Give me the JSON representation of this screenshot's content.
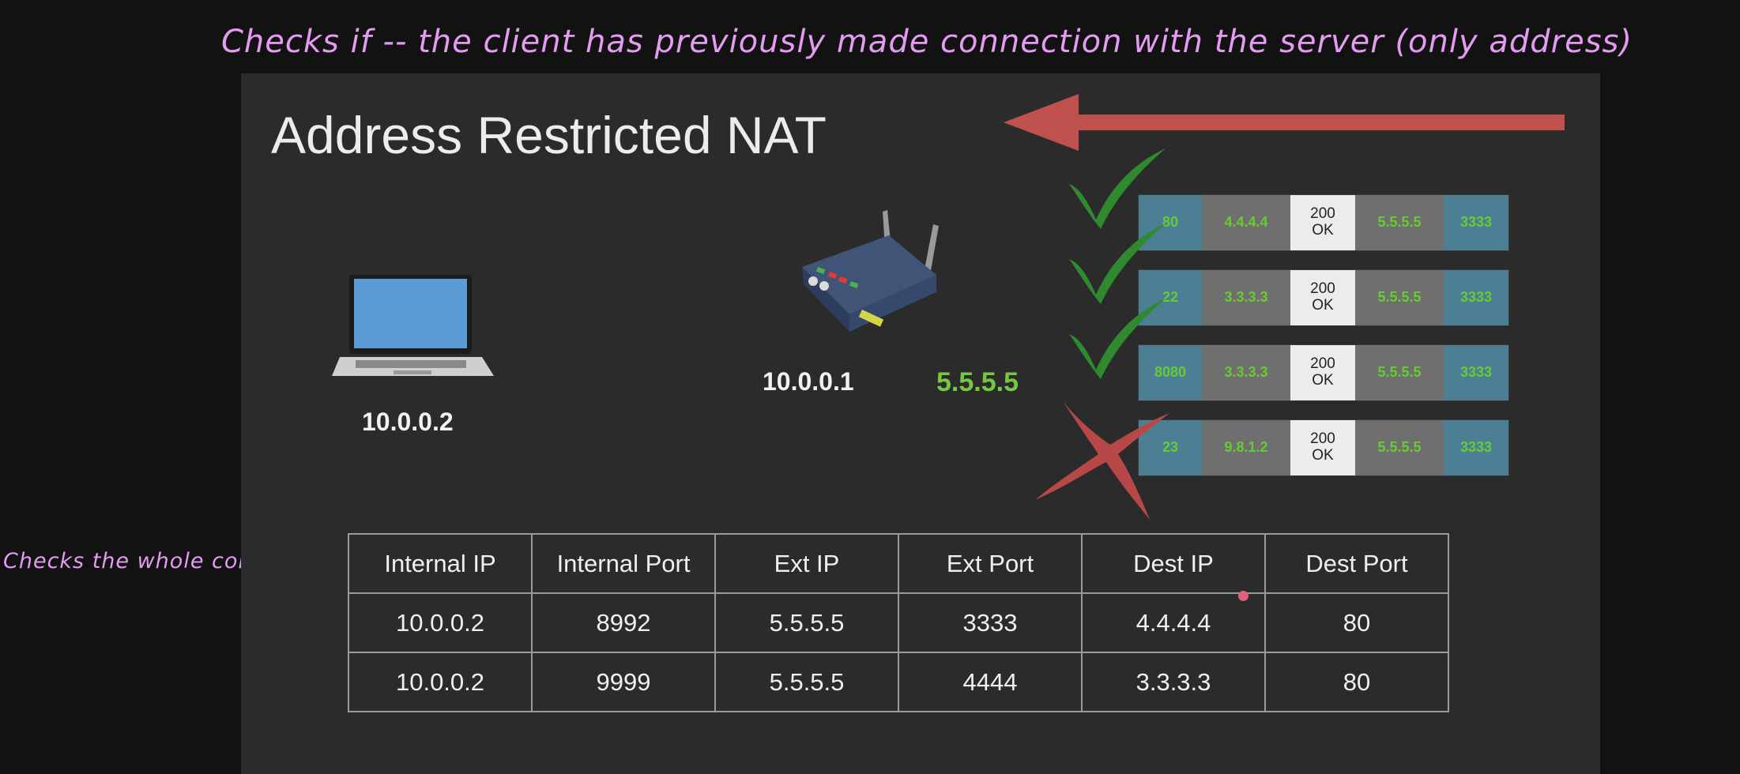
{
  "annotations": {
    "top": "Checks if -- the client has previously made connection with the server (only address)",
    "left": "Checks the whole config"
  },
  "slide": {
    "title": "Address Restricted NAT",
    "laptop_ip": "10.0.0.2",
    "router_ip": "10.0.0.1",
    "public_ip": "5.5.5.5"
  },
  "packets": [
    {
      "src_port": "80",
      "src_ip": "4.4.4.4",
      "status": "200\nOK",
      "dst_ip": "5.5.5.5",
      "dst_port": "3333",
      "result": "allowed"
    },
    {
      "src_port": "22",
      "src_ip": "3.3.3.3",
      "status": "200\nOK",
      "dst_ip": "5.5.5.5",
      "dst_port": "3333",
      "result": "allowed"
    },
    {
      "src_port": "8080",
      "src_ip": "3.3.3.3",
      "status": "200\nOK",
      "dst_ip": "5.5.5.5",
      "dst_port": "3333",
      "result": "allowed"
    },
    {
      "src_port": "23",
      "src_ip": "9.8.1.2",
      "status": "200\nOK",
      "dst_ip": "5.5.5.5",
      "dst_port": "3333",
      "result": "blocked"
    }
  ],
  "table": {
    "headers": [
      "Internal IP",
      "Internal Port",
      "Ext IP",
      "Ext Port",
      "Dest IP",
      "Dest Port"
    ],
    "rows": [
      [
        "10.0.0.2",
        "8992",
        "5.5.5.5",
        "3333",
        "4.4.4.4",
        "80"
      ],
      [
        "10.0.0.2",
        "9999",
        "5.5.5.5",
        "4444",
        "3.3.3.3",
        "80"
      ]
    ]
  },
  "colors": {
    "annotation": "#e49bf2",
    "check": "#2f8a2f",
    "cross": "#b84848",
    "arrow": "#c0504d",
    "packet_text": "#66cc33"
  }
}
